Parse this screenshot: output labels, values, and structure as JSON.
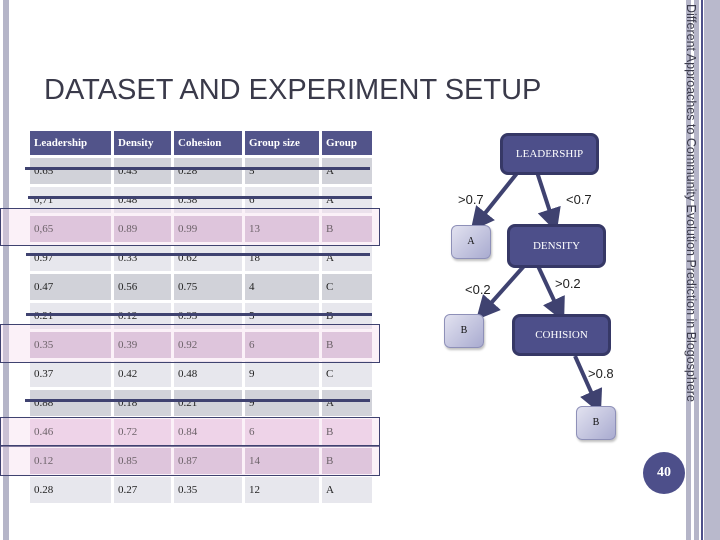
{
  "slide": {
    "title": "DATASET AND EXPERIMENT SETUP",
    "side_title": "Different Approaches to Community Evolution Prediction in Blogosphere",
    "page_number": "40"
  },
  "table": {
    "headers": [
      "Leadership",
      "Density",
      "Cohesion",
      "Group size",
      "Group"
    ],
    "rows": [
      {
        "cells": [
          "0.65",
          "0.43",
          "0.28",
          "5",
          "A"
        ],
        "struck": true,
        "highlighted": false
      },
      {
        "cells": [
          "0,71",
          "0.48",
          "0.38",
          "6",
          "A"
        ],
        "struck": true,
        "highlighted": false
      },
      {
        "cells": [
          "0,65",
          "0.89",
          "0.99",
          "13",
          "B"
        ],
        "struck": false,
        "highlighted": true
      },
      {
        "cells": [
          "0.97",
          "0.33",
          "0.62",
          "18",
          "A"
        ],
        "struck": true,
        "highlighted": false
      },
      {
        "cells": [
          "0.47",
          "0.56",
          "0.75",
          "4",
          "C"
        ],
        "struck": false,
        "highlighted": false
      },
      {
        "cells": [
          "0.21",
          "0.12",
          "0.93",
          "5",
          "B"
        ],
        "struck": true,
        "highlighted": false
      },
      {
        "cells": [
          "0.35",
          "0.39",
          "0.92",
          "6",
          "B"
        ],
        "struck": false,
        "highlighted": true
      },
      {
        "cells": [
          "0.37",
          "0.42",
          "0.48",
          "9",
          "C"
        ],
        "struck": false,
        "highlighted": false
      },
      {
        "cells": [
          "0.88",
          "0.18",
          "0.21",
          "9",
          "A"
        ],
        "struck": true,
        "highlighted": false
      },
      {
        "cells": [
          "0.46",
          "0.72",
          "0.84",
          "6",
          "B"
        ],
        "struck": false,
        "highlighted": true
      },
      {
        "cells": [
          "0.12",
          "0.85",
          "0.87",
          "14",
          "B"
        ],
        "struck": false,
        "highlighted": true
      },
      {
        "cells": [
          "0.28",
          "0.27",
          "0.35",
          "12",
          "A"
        ],
        "struck": false,
        "highlighted": false
      }
    ]
  },
  "tree": {
    "nodes": {
      "leadership": "LEADERSHIP",
      "density": "DENSITY",
      "cohesion": "COHISION",
      "leaf_a": "A",
      "leaf_b1": "B",
      "leaf_b2": "B"
    },
    "edges": {
      "leadership_to_a": ">0.7",
      "leadership_to_density": "<0.7",
      "density_to_b": "<0.2",
      "density_to_cohesion": ">0.2",
      "cohesion_to_b": ">0.8"
    }
  },
  "colors": {
    "accent": "#4d4f8a",
    "header_bg": "#52548a",
    "highlight": "#ecd2e6"
  }
}
